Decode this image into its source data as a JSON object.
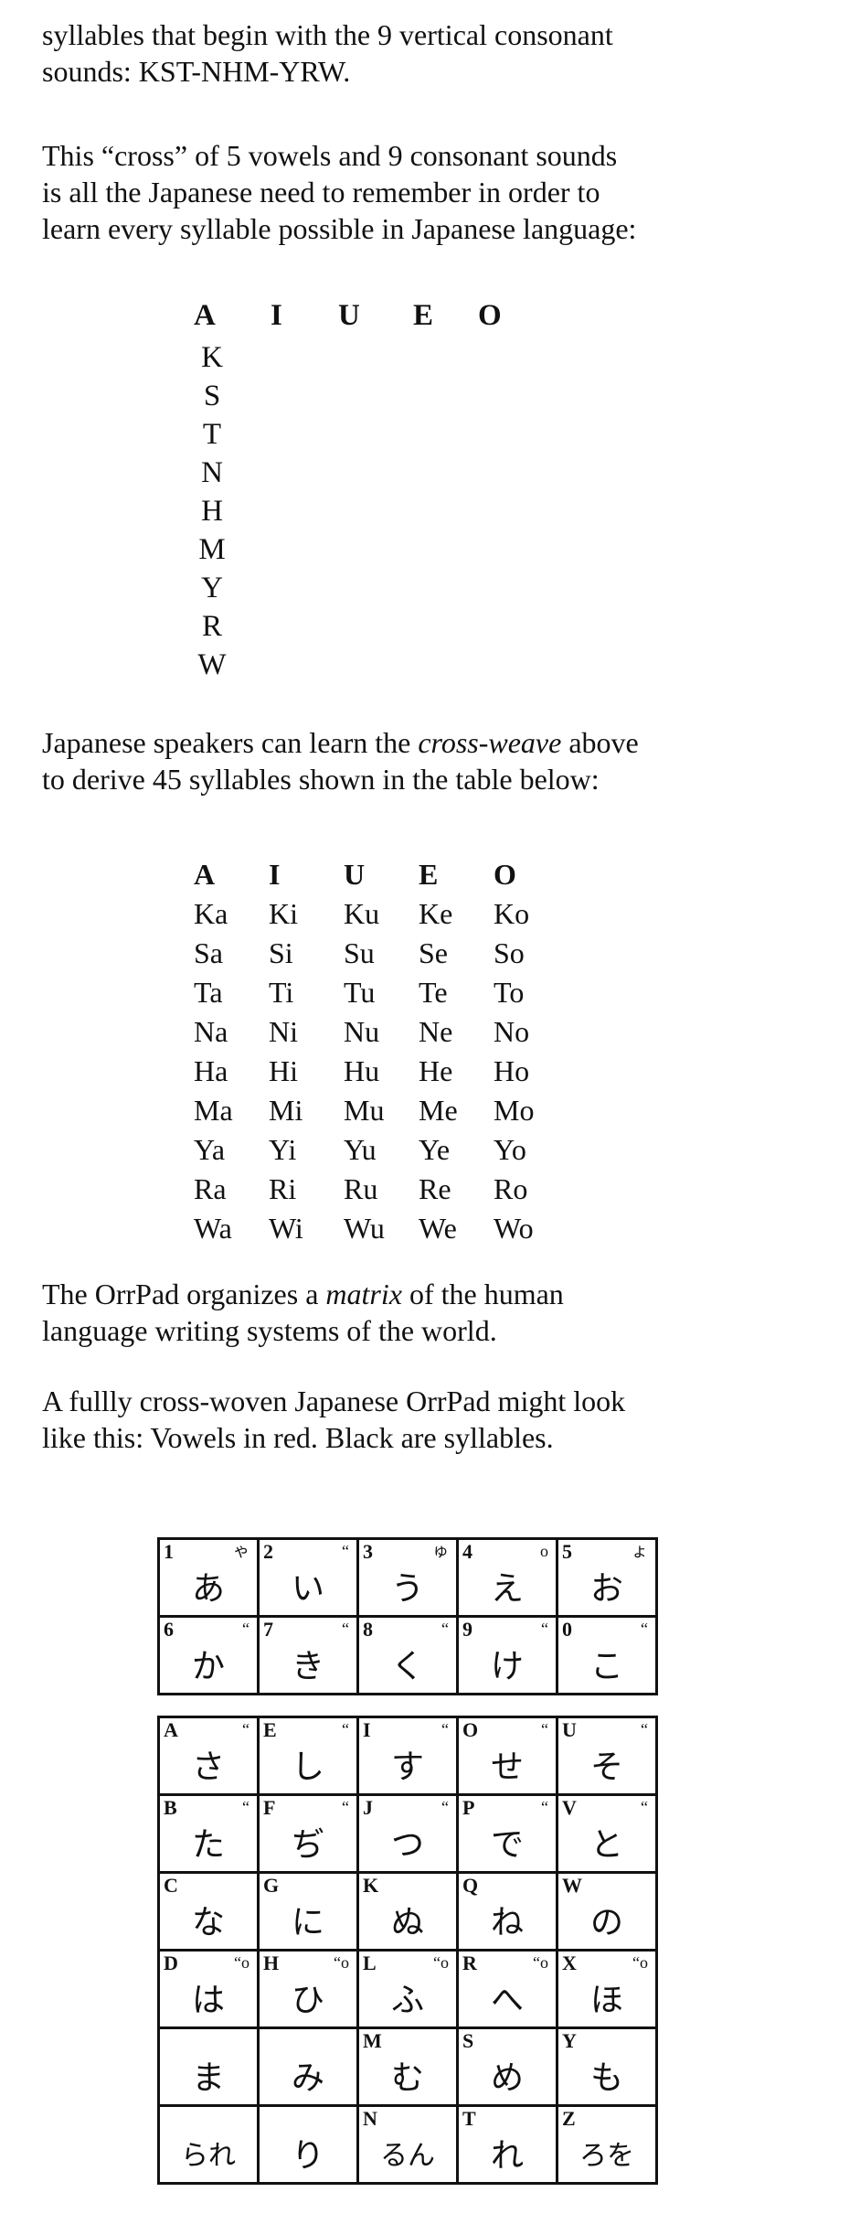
{
  "intro": {
    "line1": "syllables that begin with the 9 vertical consonant",
    "line2": "sounds: KST-NHM-YRW."
  },
  "cross_paragraph": {
    "line1": "This “cross” of 5 vowels and 9 consonant sounds",
    "line2": "is all the Japanese need to remember in order to",
    "line3": "learn every syllable possible in Japanese language:"
  },
  "cross": {
    "vowels": [
      "A",
      "I",
      "U",
      "E",
      "O"
    ],
    "consonants": [
      "K",
      "S",
      "T",
      "N",
      "H",
      "M",
      "Y",
      "R",
      "W"
    ]
  },
  "weave_paragraph": {
    "line1_before": "Japanese speakers can learn the ",
    "line1_emph": "cross-weave",
    "line1_after": " above",
    "line2": "to derive 45 syllables shown in the table below:"
  },
  "syllable_table": {
    "header": [
      "A",
      "I",
      "U",
      "E",
      "O"
    ],
    "rows": [
      [
        "Ka",
        "Ki",
        "Ku",
        "Ke",
        "Ko"
      ],
      [
        "Sa",
        "Si",
        "Su",
        "Se",
        "So"
      ],
      [
        "Ta",
        "Ti",
        "Tu",
        "Te",
        "To"
      ],
      [
        "Na",
        "Ni",
        "Nu",
        "Ne",
        "No"
      ],
      [
        "Ha",
        "Hi",
        "Hu",
        "He",
        "Ho"
      ],
      [
        "Ma",
        "Mi",
        "Mu",
        "Me",
        "Mo"
      ],
      [
        "Ya",
        "Yi",
        "Yu",
        "Ye",
        "Yo"
      ],
      [
        "Ra",
        "Ri",
        "Ru",
        "Re",
        "Ro"
      ],
      [
        "Wa",
        "Wi",
        "Wu",
        "We",
        "Wo"
      ]
    ]
  },
  "matrix_paragraph": {
    "line1_before": "The OrrPad organizes a ",
    "line1_emph": "matrix",
    "line1_after": " of the human",
    "line2": "language writing systems of the world."
  },
  "orrpad_paragraph": {
    "line1": "A fullly cross-woven Japanese OrrPad might look",
    "line2": "like this: Vowels in red. Black are syllables."
  },
  "orrpad_top": [
    [
      {
        "label": "1",
        "mark": "ゃ",
        "kana": "あ"
      },
      {
        "label": "2",
        "mark": "“",
        "kana": "い"
      },
      {
        "label": "3",
        "mark": "ゅ",
        "kana": "う"
      },
      {
        "label": "4",
        "mark": "o",
        "kana": "え"
      },
      {
        "label": "5",
        "mark": "ょ",
        "kana": "お"
      }
    ],
    [
      {
        "label": "6",
        "mark": "“",
        "kana": "か"
      },
      {
        "label": "7",
        "mark": "“",
        "kana": "き"
      },
      {
        "label": "8",
        "mark": "“",
        "kana": "く"
      },
      {
        "label": "9",
        "mark": "“",
        "kana": "け"
      },
      {
        "label": "0",
        "mark": "“",
        "kana": "こ"
      }
    ]
  ],
  "orrpad_main": [
    [
      {
        "label": "A",
        "mark": "“",
        "kana": "さ"
      },
      {
        "label": "E",
        "mark": "“",
        "kana": "し"
      },
      {
        "label": "I",
        "mark": "“",
        "kana": "す"
      },
      {
        "label": "O",
        "mark": "“",
        "kana": "せ"
      },
      {
        "label": "U",
        "mark": "“",
        "kana": "そ"
      }
    ],
    [
      {
        "label": "B",
        "mark": "“",
        "kana": "た"
      },
      {
        "label": "F",
        "mark": "“",
        "kana": "ぢ"
      },
      {
        "label": "J",
        "mark": "“",
        "kana": "つ"
      },
      {
        "label": "P",
        "mark": "“",
        "kana": "で"
      },
      {
        "label": "V",
        "mark": "“",
        "kana": "と"
      }
    ],
    [
      {
        "label": "C",
        "mark": "",
        "kana": "な"
      },
      {
        "label": "G",
        "mark": "",
        "kana": "に"
      },
      {
        "label": "K",
        "mark": "",
        "kana": "ぬ"
      },
      {
        "label": "Q",
        "mark": "",
        "kana": "ね"
      },
      {
        "label": "W",
        "mark": "",
        "kana": "の"
      }
    ],
    [
      {
        "label": "D",
        "mark": "“o",
        "kana": "は"
      },
      {
        "label": "H",
        "mark": "“o",
        "kana": "ひ"
      },
      {
        "label": "L",
        "mark": "“o",
        "kana": "ふ"
      },
      {
        "label": "R",
        "mark": "“o",
        "kana": "へ"
      },
      {
        "label": "X",
        "mark": "“o",
        "kana": "ほ"
      }
    ],
    [
      {
        "label": "",
        "mark": "",
        "kana": "ま"
      },
      {
        "label": "",
        "mark": "",
        "kana": "み"
      },
      {
        "label": "M",
        "mark": "",
        "kana": "む"
      },
      {
        "label": "S",
        "mark": "",
        "kana": "め"
      },
      {
        "label": "Y",
        "mark": "",
        "kana": "も"
      }
    ],
    [
      {
        "label": "",
        "mark": "",
        "kana": "られ"
      },
      {
        "label": "",
        "mark": "",
        "kana": "り"
      },
      {
        "label": "N",
        "mark": "",
        "kana": "るん"
      },
      {
        "label": "T",
        "mark": "",
        "kana": "れ"
      },
      {
        "label": "Z",
        "mark": "",
        "kana": "ろを"
      }
    ]
  ]
}
